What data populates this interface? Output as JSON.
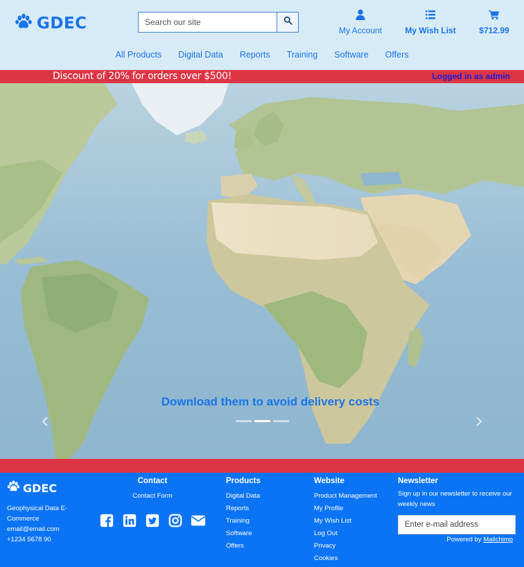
{
  "brand": {
    "name": "GDEC",
    "color": "#1a73e8"
  },
  "search": {
    "placeholder": "Search our site"
  },
  "header_links": {
    "account": "My Account",
    "wishlist": "My Wish List",
    "cart": "$712.99"
  },
  "nav": [
    "All Products",
    "Digital Data",
    "Reports",
    "Training",
    "Software",
    "Offers"
  ],
  "promo": {
    "text": "Discount of 20% for orders over $500!",
    "login_status": "Logged in as admin",
    "color": "#dc3545"
  },
  "hero": {
    "caption": "Download them to avoid delivery costs",
    "slide_count": 3,
    "active_slide": 1
  },
  "footer": {
    "brand": "GDEC",
    "company_name": "Geophysical Data E-Commerce",
    "email": "email@email.com",
    "phone": "+1234 5678 90",
    "contact": {
      "title": "Contact",
      "items": [
        "Contact Form"
      ]
    },
    "products": {
      "title": "Products",
      "items": [
        "Digital Data",
        "Reports",
        "Training",
        "Software",
        "Offers"
      ]
    },
    "website": {
      "title": "Website",
      "items": [
        "Product Management",
        "My Profile",
        "My Wish List",
        "Log Out",
        "Privacy",
        "Cookies"
      ]
    },
    "newsletter": {
      "title": "Newsletter",
      "text": "Sign up in our newsletter to receive our weekly news",
      "placeholder": "Enter e-mail address",
      "powered_prefix": "Powered by",
      "powered_link": "Mailchimp"
    },
    "social_icons": [
      "facebook-icon",
      "linkedin-icon",
      "twitter-icon",
      "instagram-icon",
      "envelope-icon"
    ],
    "color": "#0b74f5"
  }
}
